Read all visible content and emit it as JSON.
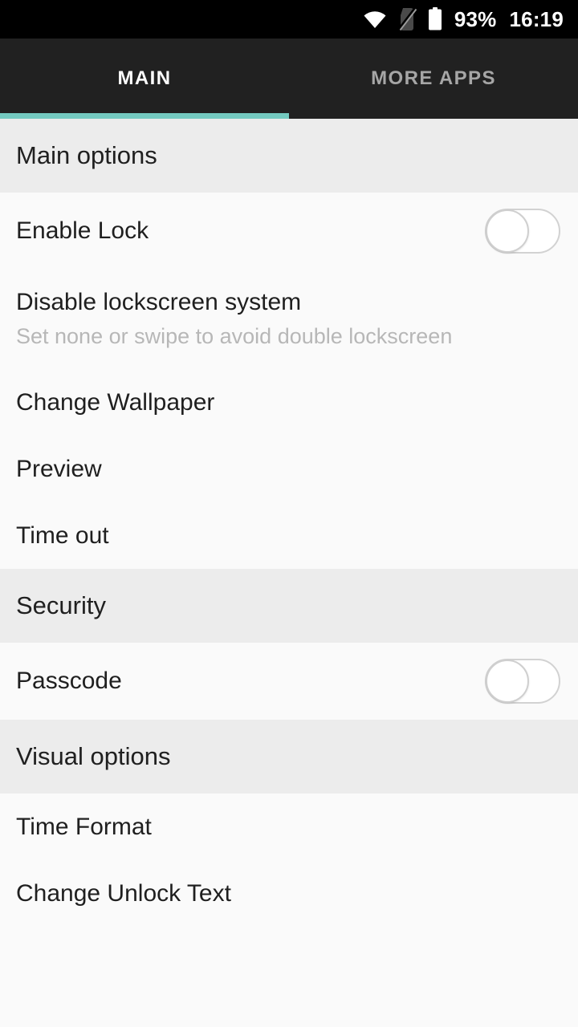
{
  "statusbar": {
    "wifi_icon": "wifi-icon",
    "sim_icon": "no-sim-icon",
    "battery_icon": "battery-icon",
    "battery_percent": "93%",
    "clock": "16:19"
  },
  "tabs": {
    "items": [
      {
        "label": "MAIN",
        "active": true
      },
      {
        "label": "MORE APPS",
        "active": false
      }
    ],
    "indicator_color": "#74cac0"
  },
  "sections": [
    {
      "header": "Main options",
      "rows": [
        {
          "title": "Enable Lock",
          "type": "toggle",
          "toggle_state": "off"
        },
        {
          "title": "Disable lockscreen system",
          "subtitle": "Set none or swipe to avoid double lockscreen",
          "type": "two-line"
        },
        {
          "title": "Change Wallpaper",
          "type": "simple"
        },
        {
          "title": "Preview",
          "type": "simple"
        },
        {
          "title": "Time out",
          "type": "simple"
        }
      ]
    },
    {
      "header": "Security",
      "rows": [
        {
          "title": "Passcode",
          "type": "toggle",
          "toggle_state": "off"
        }
      ]
    },
    {
      "header": "Visual options",
      "rows": [
        {
          "title": "Time Format",
          "type": "simple"
        },
        {
          "title": "Change Unlock Text",
          "type": "simple"
        }
      ]
    }
  ],
  "colors": {
    "statusbar_bg": "#000000",
    "tabbar_bg": "#212121",
    "accent_teal": "#74cac0",
    "section_header_bg": "#ececec",
    "list_bg": "#fafafa",
    "primary_text": "#1f1f1f",
    "secondary_text": "#b7b7b7",
    "tab_inactive_text": "#a6a6a6"
  }
}
